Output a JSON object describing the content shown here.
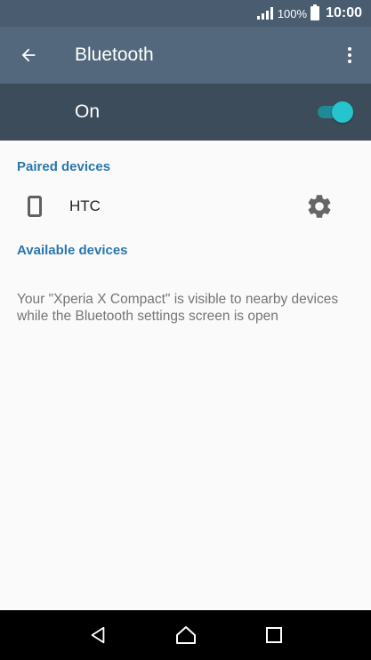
{
  "status_bar": {
    "battery_percent": "100%",
    "time": "10:00"
  },
  "app_bar": {
    "title": "Bluetooth",
    "back_icon": "arrow-back-icon",
    "menu_icon": "more-vert-icon"
  },
  "bluetooth_switch": {
    "label": "On",
    "enabled": true,
    "accent_color": "#26c4cc"
  },
  "paired_devices": {
    "header": "Paired devices",
    "items": [
      {
        "name": "HTC",
        "icon": "phone-icon",
        "settings_icon": "gear-icon"
      }
    ]
  },
  "available_devices": {
    "header": "Available devices"
  },
  "visibility_note": "Your \"Xperia X Compact\" is visible to nearby devices while the Bluetooth settings screen is open",
  "nav_bar": {
    "buttons": [
      "back-nav-icon",
      "home-nav-icon",
      "recents-nav-icon"
    ]
  },
  "colors": {
    "app_bar": "#53687c",
    "switch_bar": "#3d4c5a",
    "section_header": "#2a77ad"
  }
}
